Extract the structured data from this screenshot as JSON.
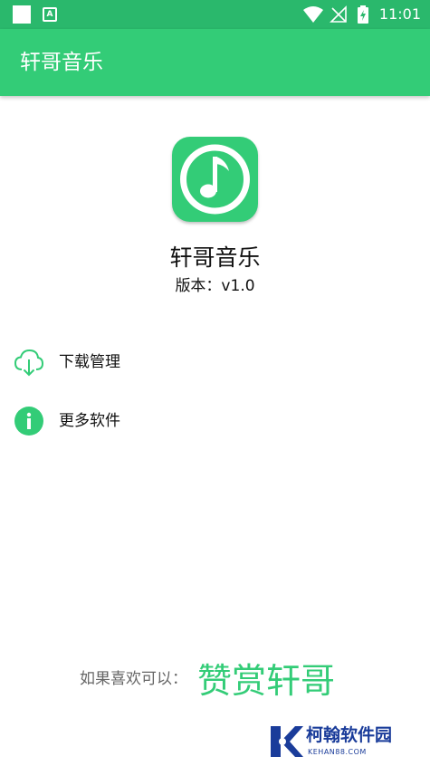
{
  "status_bar": {
    "time": "11:01",
    "icons": [
      "notification-square-icon",
      "accessibility-a-icon",
      "wifi-icon",
      "no-signal-icon",
      "battery-charging-icon"
    ]
  },
  "app_bar": {
    "title": "轩哥音乐"
  },
  "about": {
    "app_name": "轩哥音乐",
    "version": "版本：v1.0",
    "logo_icon": "music-note-icon"
  },
  "menu": [
    {
      "label": "下载管理",
      "icon": "cloud-download-icon"
    },
    {
      "label": "更多软件",
      "icon": "info-icon"
    }
  ],
  "footer": {
    "prefix": "如果喜欢可以：",
    "link": "赞赏轩哥"
  },
  "watermark": {
    "name": "柯翰软件园",
    "domain": "KEHAN88.COM"
  },
  "colors": {
    "primary": "#33cc77",
    "status_bar": "#2ab86c",
    "text": "#111111",
    "muted": "#666666",
    "watermark": "#1a3c9a"
  }
}
